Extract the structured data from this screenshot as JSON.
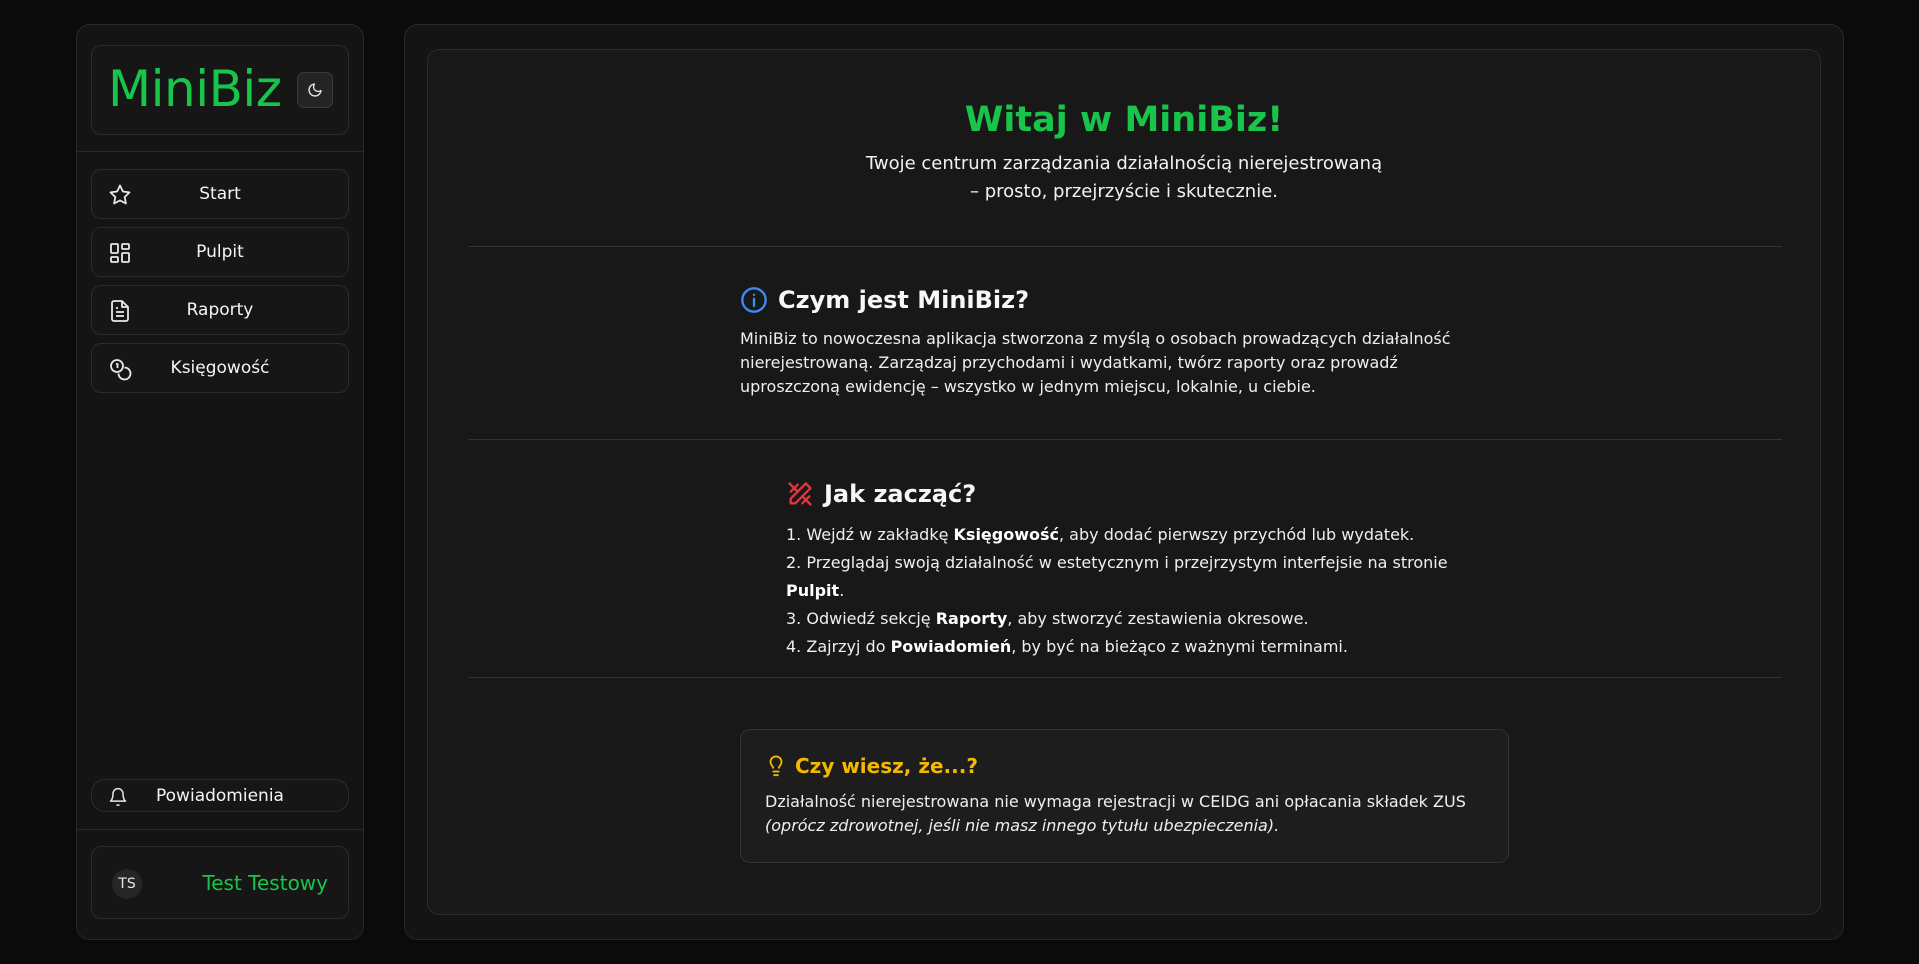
{
  "app": {
    "name": "MiniBiz",
    "theme_toggle_icon": "moon-icon",
    "brand_color": "#19c44a"
  },
  "sidebar": {
    "items": [
      {
        "label": "Start",
        "icon": "star-icon"
      },
      {
        "label": "Pulpit",
        "icon": "dashboard-icon"
      },
      {
        "label": "Raporty",
        "icon": "document-icon"
      },
      {
        "label": "Księgowość",
        "icon": "coins-icon"
      }
    ],
    "notifications": {
      "label": "Powiadomienia",
      "icon": "bell-icon"
    },
    "user": {
      "initials": "TS",
      "name": "Test Testowy"
    }
  },
  "hero": {
    "title": "Witaj w MiniBiz!",
    "subtitle_line1": "Twoje centrum zarządzania działalnością nierejestrowaną",
    "subtitle_line2": "– prosto, przejrzyście i skutecznie."
  },
  "about": {
    "title": "Czym jest MiniBiz?",
    "icon": "info-icon",
    "text": "MiniBiz to nowoczesna aplikacja stworzona z myślą o osobach prowadzących działalność nierejestrowaną. Zarządzaj przychodami i wydatkami, twórz raporty oraz prowadź uproszczoną ewidencję – wszystko w jednym miejscu, lokalnie, u ciebie."
  },
  "getting_started": {
    "title": "Jak zacząć?",
    "icon": "tools-icon",
    "steps": [
      {
        "pre": "1. Wejdź w zakładkę ",
        "bold": "Księgowość",
        "post": ", aby dodać pierwszy przychód lub wydatek."
      },
      {
        "pre": "2. Przeglądaj swoją działalność w estetycznym i przejrzystym interfejsie na stronie ",
        "bold": "Pulpit",
        "post": "."
      },
      {
        "pre": "3. Odwiedź sekcję ",
        "bold": "Raporty",
        "post": ", aby stworzyć zestawienia okresowe."
      },
      {
        "pre": "4. Zajrzyj do ",
        "bold": "Powiadomień",
        "post": ", by być na bieżąco z ważnymi terminami."
      }
    ]
  },
  "tip": {
    "title": "Czy wiesz, że...?",
    "icon": "lightbulb-icon",
    "text": "Działalność nierejestrowana nie wymaga rejestracji w CEIDG ani opłacania składek ZUS",
    "note": "(oprócz zdrowotnej, jeśli nie masz innego tytułu ubezpieczenia)."
  }
}
